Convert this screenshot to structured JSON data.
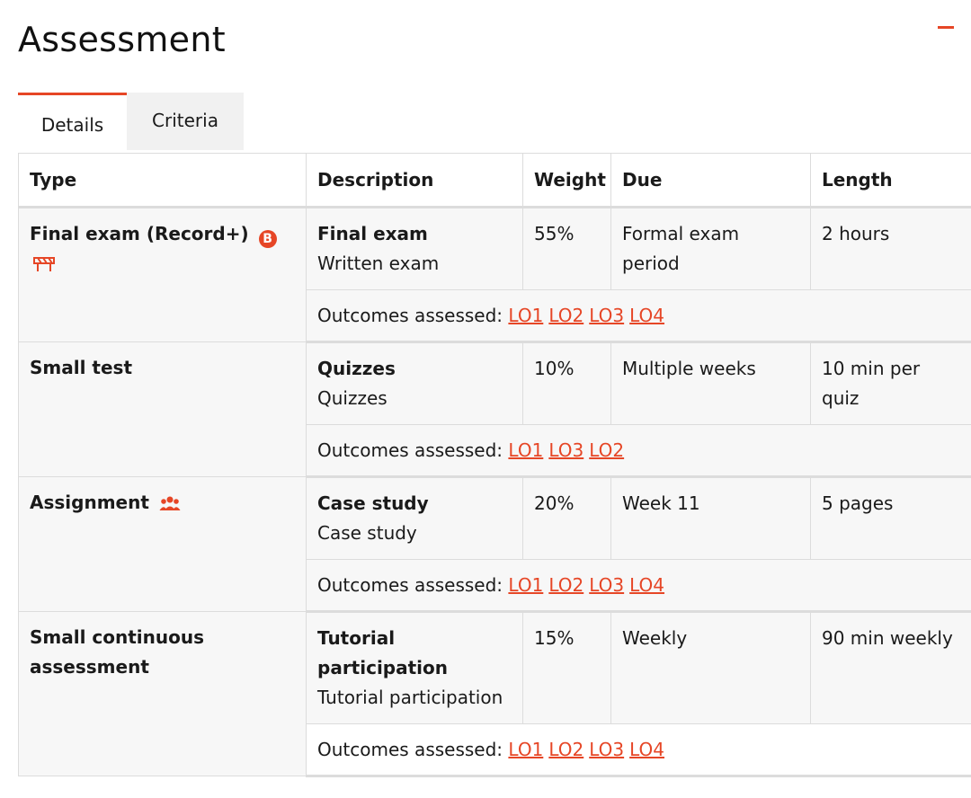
{
  "page": {
    "title": "Assessment"
  },
  "tabs": [
    {
      "label": "Details",
      "active": true
    },
    {
      "label": "Criteria",
      "active": false
    }
  ],
  "table": {
    "headers": [
      "Type",
      "Description",
      "Weight",
      "Due",
      "Length"
    ],
    "outcomes_label": "Outcomes assessed:",
    "rows": [
      {
        "type": "Final exam (Record+)",
        "icons": [
          "hurdle-b-icon",
          "barrier-icon"
        ],
        "desc_title": "Final exam",
        "desc_sub": "Written exam",
        "weight": "55%",
        "due": "Formal exam period",
        "length": "2 hours",
        "outcomes": [
          "LO1",
          "LO2",
          "LO3",
          "LO4"
        ]
      },
      {
        "type": "Small test",
        "icons": [],
        "desc_title": "Quizzes",
        "desc_sub": "Quizzes",
        "weight": "10%",
        "due": "Multiple weeks",
        "length": "10 min per quiz",
        "outcomes": [
          "LO1",
          "LO3",
          "LO2"
        ]
      },
      {
        "type": "Assignment",
        "icons": [
          "group-work-icon"
        ],
        "desc_title": "Case study",
        "desc_sub": "Case study",
        "weight": "20%",
        "due": "Week 11",
        "length": "5 pages",
        "outcomes": [
          "LO1",
          "LO2",
          "LO3",
          "LO4"
        ]
      },
      {
        "type": "Small continuous assessment",
        "icons": [],
        "desc_title": "Tutorial participation",
        "desc_sub": "Tutorial participation",
        "weight": "15%",
        "due": "Weekly",
        "length": "90 min weekly",
        "outcomes": [
          "LO1",
          "LO2",
          "LO3",
          "LO4"
        ]
      }
    ]
  },
  "colors": {
    "accent": "#e64626",
    "row_bg": "#f7f7f7",
    "border": "#dcdcdc"
  }
}
